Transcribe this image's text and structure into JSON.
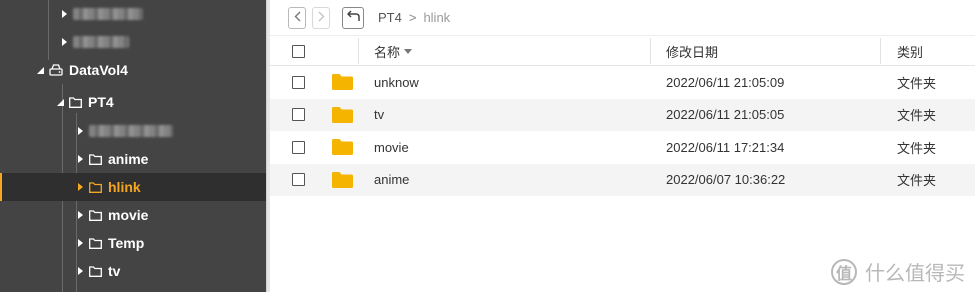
{
  "sidebar": {
    "volume": {
      "label": "DataVol4",
      "icon": "drive-icon"
    },
    "share": {
      "label": "PT4",
      "icon": "folder-outline-icon"
    },
    "folders": [
      {
        "label": "anime",
        "icon": "folder-outline-icon",
        "selected": false
      },
      {
        "label": "hlink",
        "icon": "folder-outline-icon",
        "selected": true
      },
      {
        "label": "movie",
        "icon": "folder-outline-icon",
        "selected": false
      },
      {
        "label": "Temp",
        "icon": "folder-outline-icon",
        "selected": false
      },
      {
        "label": "tv",
        "icon": "folder-outline-icon",
        "selected": false
      }
    ],
    "accent_color": "#f5a623"
  },
  "toolbar": {
    "back_icon": "chevron-left-icon",
    "forward_icon": "chevron-right-icon",
    "up_icon": "return-up-icon",
    "breadcrumb": [
      "PT4",
      "hlink"
    ],
    "breadcrumb_separator": ">"
  },
  "table": {
    "columns": {
      "name": "名称",
      "modified": "修改日期",
      "type": "类别"
    },
    "sort_icon": "caret-down-icon",
    "rows": [
      {
        "name": "unknow",
        "modified": "2022/06/11 21:05:09",
        "type": "文件夹"
      },
      {
        "name": "tv",
        "modified": "2022/06/11 21:05:05",
        "type": "文件夹"
      },
      {
        "name": "movie",
        "modified": "2022/06/11 17:21:34",
        "type": "文件夹"
      },
      {
        "name": "anime",
        "modified": "2022/06/07 10:36:22",
        "type": "文件夹"
      }
    ],
    "folder_color": "#f5b400"
  },
  "watermark": {
    "logo": "值",
    "text": "什么值得买"
  }
}
